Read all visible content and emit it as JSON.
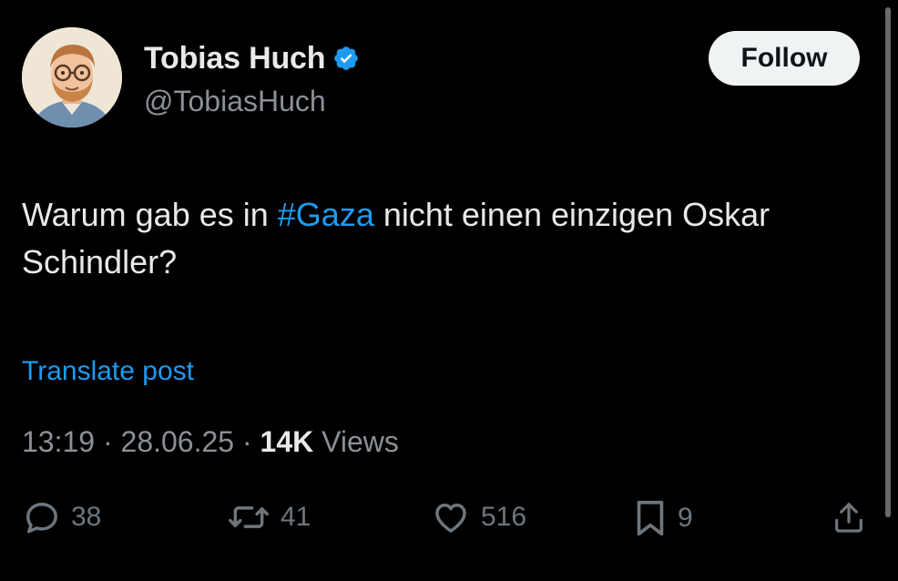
{
  "author": {
    "display_name": "Tobias Huch",
    "handle": "@TobiasHuch",
    "verified_icon": "verified-badge-icon"
  },
  "follow_button": {
    "label": "Follow"
  },
  "post": {
    "text_before": "Warum gab es in ",
    "hashtag": "#Gaza",
    "text_after": " nicht einen einzigen Oskar Schindler?"
  },
  "translate": {
    "label": "Translate post"
  },
  "meta": {
    "time": "13:19",
    "separator": " · ",
    "date": "28.06.25",
    "views_count": "14K",
    "views_label": " Views"
  },
  "actions": {
    "reply": {
      "icon": "reply-icon",
      "count": "38"
    },
    "repost": {
      "icon": "repost-icon",
      "count": "41"
    },
    "like": {
      "icon": "heart-icon",
      "count": "516"
    },
    "bookmark": {
      "icon": "bookmark-icon",
      "count": "9"
    },
    "share": {
      "icon": "share-icon"
    }
  },
  "colors": {
    "background": "#000000",
    "text": "#e7e9ea",
    "secondary_text": "#8b9096",
    "accent": "#1d9bf0",
    "action_icons": "#6e767d",
    "follow_bg": "#eff3f4"
  }
}
